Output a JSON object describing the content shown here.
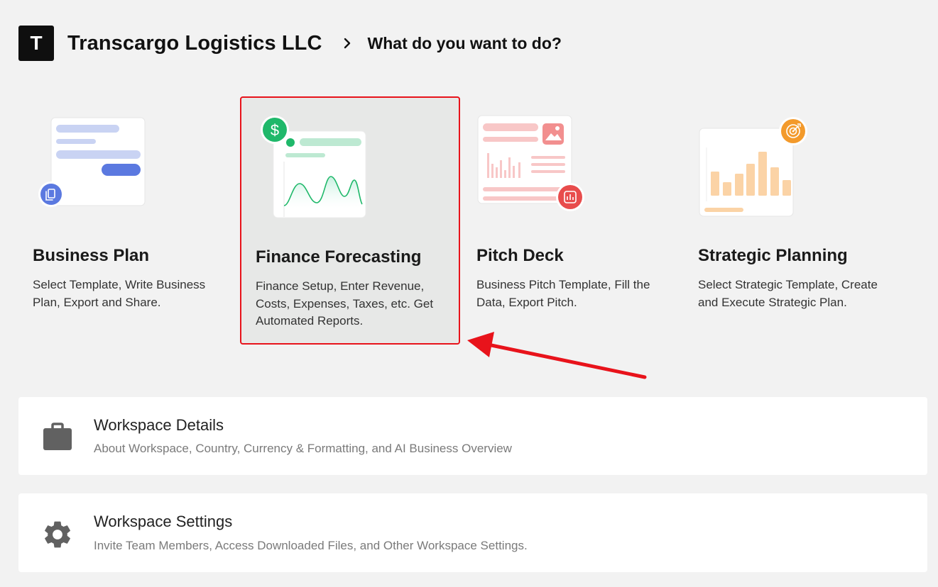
{
  "header": {
    "logo_letter": "T",
    "company_name": "Transcargo Logistics LLC",
    "page_title": "What do you want to do?"
  },
  "cards": [
    {
      "title": "Business Plan",
      "description": "Select Template, Write Business Plan, Export and Share."
    },
    {
      "title": "Finance Forecasting",
      "description": "Finance Setup, Enter Revenue, Costs, Expenses, Taxes, etc. Get Automated Reports.",
      "selected": true
    },
    {
      "title": "Pitch Deck",
      "description": "Business Pitch Template, Fill the Data, Export Pitch."
    },
    {
      "title": "Strategic Planning",
      "description": "Select Strategic Template, Create and Execute Strategic Plan."
    }
  ],
  "panels": [
    {
      "title": "Workspace Details",
      "description": "About Workspace, Country, Currency & Formatting, and AI Business Overview",
      "icon": "briefcase-icon"
    },
    {
      "title": "Workspace Settings",
      "description": "Invite Team Members, Access Downloaded Files, and Other Workspace Settings.",
      "icon": "gear-icon"
    }
  ],
  "colors": {
    "selected_border": "#e8131b",
    "annotation_arrow": "#e8131b",
    "finance_accent": "#1fb86a",
    "business_accent": "#5b79e0",
    "pitch_accent": "#e84c4c",
    "strategic_accent": "#f39a2b"
  }
}
